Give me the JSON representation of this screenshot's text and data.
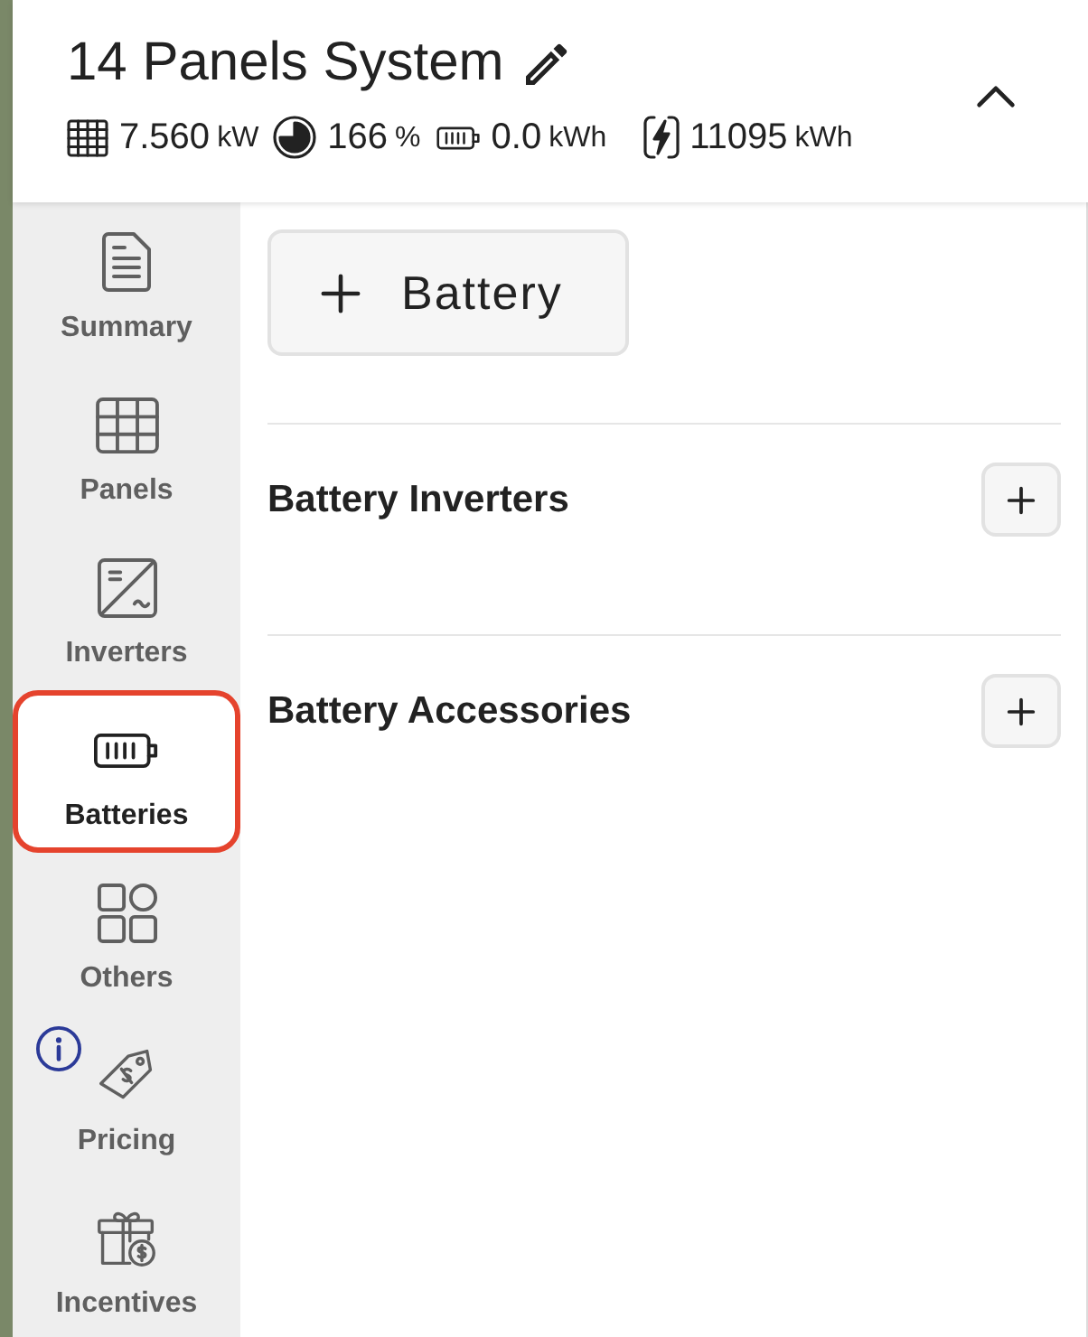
{
  "header": {
    "title": "14 Panels System",
    "expanded": true,
    "stats": [
      {
        "value": "7.560",
        "unit": "kW"
      },
      {
        "value": "166",
        "unit": "%"
      },
      {
        "value": "0.0",
        "unit": "kWh"
      },
      {
        "value": "11095",
        "unit": "kWh"
      }
    ]
  },
  "sidebar": {
    "items": [
      {
        "label": "Summary",
        "selected": false,
        "info_badge": false
      },
      {
        "label": "Panels",
        "selected": false,
        "info_badge": false
      },
      {
        "label": "Inverters",
        "selected": false,
        "info_badge": false
      },
      {
        "label": "Batteries",
        "selected": true,
        "info_badge": false
      },
      {
        "label": "Others",
        "selected": false,
        "info_badge": false
      },
      {
        "label": "Pricing",
        "selected": false,
        "info_badge": true
      },
      {
        "label": "Incentives",
        "selected": false,
        "info_badge": false
      }
    ]
  },
  "main": {
    "add_button": {
      "label": "Battery"
    },
    "sections": [
      {
        "title": "Battery Inverters"
      },
      {
        "title": "Battery Accessories"
      }
    ]
  }
}
